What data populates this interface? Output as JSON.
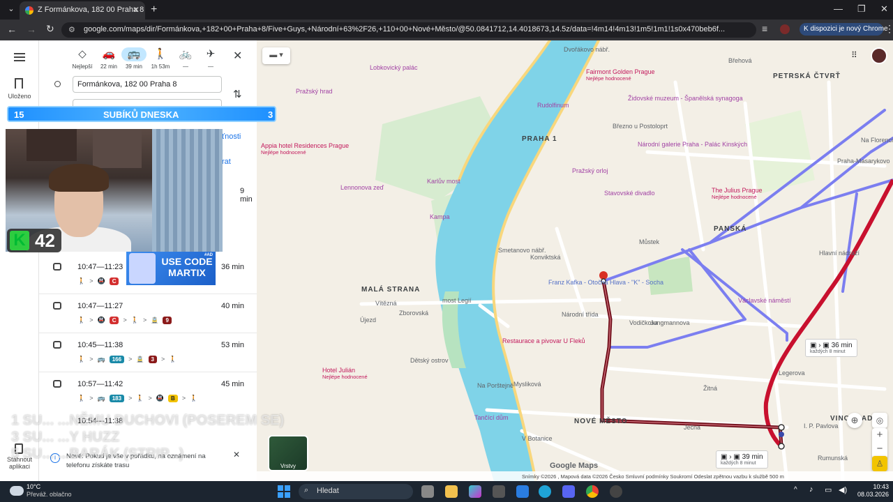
{
  "browser": {
    "tab_title": "Z Formánkova, 182 00 Praha 8 – ",
    "url": "google.com/maps/dir/Formánkova,+182+00+Praha+8/Five+Guys,+Národní+63%2F26,+110+00+Nové+Město/@50.0841712,14.4018673,14.5z/data=!4m14!4m13!1m5!1m1!1s0x470beb6f...",
    "promo_label": "K dispozici je nový Chrome"
  },
  "rail": {
    "saved_label": "Uloženo",
    "apps_label": "Stáhnout aplikaci"
  },
  "modes": [
    {
      "name": "best",
      "label": "Nejlepší",
      "icon": "◇"
    },
    {
      "name": "car",
      "label": "22 min",
      "icon": "🚗"
    },
    {
      "name": "transit",
      "label": "39 min",
      "icon": "🚌"
    },
    {
      "name": "walk",
      "label": "1h 53m",
      "icon": "🚶"
    },
    {
      "name": "bike",
      "label": "—",
      "icon": "🚲"
    },
    {
      "name": "flight",
      "label": "—",
      "icon": "✈"
    }
  ],
  "directions": {
    "origin": "Formánkova, 182 00 Praha 8",
    "options_partial": "ťnosti",
    "leave_partial": "rat",
    "first_duration_partial": "9 min"
  },
  "routes": [
    {
      "time": "10:47—11:23",
      "duration": "36 min",
      "steps": [
        {
          "t": "🚶"
        },
        {
          "t": ">"
        },
        {
          "t": "🚇"
        },
        {
          "b": "C",
          "c": "#d32f2f"
        }
      ]
    },
    {
      "time": "10:47—11:27",
      "duration": "40 min",
      "steps": [
        {
          "t": "🚶"
        },
        {
          "t": ">"
        },
        {
          "t": "🚇"
        },
        {
          "b": "C",
          "c": "#d32f2f"
        },
        {
          "t": ">"
        },
        {
          "t": "🚶"
        },
        {
          "t": ">"
        },
        {
          "t": "🚊"
        },
        {
          "b": "9",
          "c": "#8b1a1a"
        }
      ]
    },
    {
      "time": "10:45—11:38",
      "duration": "53 min",
      "steps": [
        {
          "t": "🚶"
        },
        {
          "t": ">"
        },
        {
          "t": "🚌"
        },
        {
          "b": "166",
          "c": "#1a8aa8"
        },
        {
          "t": ">"
        },
        {
          "t": "🚊"
        },
        {
          "b": "3",
          "c": "#8b1a1a"
        },
        {
          "t": ">"
        },
        {
          "t": "🚶"
        }
      ]
    },
    {
      "time": "10:57—11:42",
      "duration": "45 min",
      "steps": [
        {
          "t": "🚶"
        },
        {
          "t": ">"
        },
        {
          "t": "🚌"
        },
        {
          "b": "183",
          "c": "#1a8aa8"
        },
        {
          "t": ">"
        },
        {
          "t": "🚶"
        },
        {
          "t": ">"
        },
        {
          "t": "🚇"
        },
        {
          "b": "B",
          "c": "#f2c200"
        },
        {
          "t": ">"
        },
        {
          "t": "🚶"
        }
      ]
    }
  ],
  "notification": "Nové: Pokud je vše v pořádku, na oznámení na telefonu získáte trasu",
  "overlay": {
    "sub_left": "15",
    "sub_title": "SUBÍKŮ DNESKA",
    "sub_right": "3",
    "k_count": "42",
    "martix": "USE CODE MARTIX",
    "martix_ad": "#AD",
    "line1": "1 SU...   ...NĚMU DUCHOVI (POSEREM SE)",
    "line2": "3 SU...   ...Y HUZZ",
    "line3": "5 SU...   ...BARÁK (STRIP...)"
  },
  "map": {
    "districts": [
      "PRAHA 1",
      "MALÁ STRANA",
      "NOVÉ MĚSTO",
      "PETRSKÁ ČTVRŤ",
      "PANSKÁ",
      "VINOHRADY"
    ],
    "pois": [
      {
        "name": "Lobkovický palác",
        "cls": "poi"
      },
      {
        "name": "Fairmont Golden Prague",
        "sub": "Nejlépe hodnocené",
        "cls": "poi pink"
      },
      {
        "name": "Pražský hrad",
        "cls": "poi"
      },
      {
        "name": "Židovské muzeum - Španělská synagoga",
        "cls": "poi"
      },
      {
        "name": "Rudolfinum",
        "cls": "poi"
      },
      {
        "name": "Appia hotel Residences Prague",
        "sub": "Nejlépe hodnocené",
        "cls": "poi pink"
      },
      {
        "name": "Národní galerie Praha - Palác Kinských",
        "cls": "poi"
      },
      {
        "name": "Pražský orloj",
        "cls": "poi"
      },
      {
        "name": "Lennonova zeď",
        "cls": "poi"
      },
      {
        "name": "Karlův most",
        "cls": "poi"
      },
      {
        "name": "Stavovské divadlo",
        "cls": "poi"
      },
      {
        "name": "The Julius Prague",
        "sub": "Nejlépe hodnocené",
        "cls": "poi pink"
      },
      {
        "name": "Kampa",
        "cls": "poi"
      },
      {
        "name": "Franz Kafka - Otočná Hlava - \"K\" - Socha",
        "cls": "poi blue"
      },
      {
        "name": "Václavské náměstí",
        "cls": "poi"
      },
      {
        "name": "Restaurace a pivovar U Fleků",
        "cls": "poi pink"
      },
      {
        "name": "Hotel Julián",
        "sub": "Nejlépe hodnocené",
        "cls": "poi pink"
      },
      {
        "name": "Tančící dům",
        "cls": "poi"
      }
    ],
    "streets": [
      "Dvořákovo nábř.",
      "Břehová",
      "Březno u Postoloprt",
      "Můstek",
      "Národní třída",
      "Vítězná",
      "most Legií",
      "Újezd",
      "Zborovská",
      "Dětský ostrov",
      "Žitná",
      "Ječná",
      "I. P. Pavlova",
      "Hlavní nádraží",
      "Na Florenci",
      "Praha-Masarykovo",
      "Konviktská",
      "Smetanovo nábř.",
      "Mysliková",
      "Vodičkova",
      "Jungmannova",
      "Legerova",
      "Rumunská",
      "V Botanice",
      "Na Porštejně"
    ],
    "tag_36": "36 min",
    "tag_36_sub": "každých 8 minut",
    "tag_39": "39 min",
    "tag_39_sub": "každých 8 minut",
    "layers": "Vrstvy",
    "footer": "Snímky ©2026 , Mapová data ©2026   Česko   Smluvní podmínky   Soukromí   Odeslat zpětnou vazbu k službě   500 m",
    "colors": {
      "route_blue": "#7b7ef0",
      "route_red": "#c8102e",
      "route_dark": "#6d0a16",
      "water": "#7fd3e8",
      "park": "#c8e6c0"
    }
  },
  "taskbar": {
    "weather_temp": "10°C",
    "weather_desc": "Převáž. oblačno",
    "search": "Hledat",
    "time": "10:43",
    "date": "08.03.2026"
  }
}
